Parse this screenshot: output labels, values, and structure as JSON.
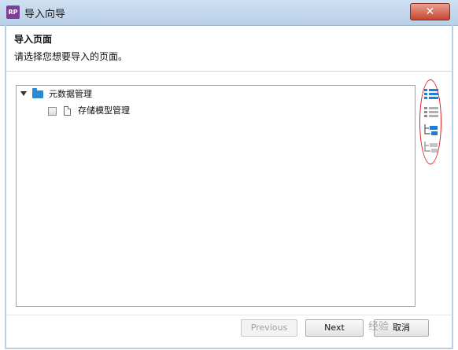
{
  "window": {
    "app_icon_text": "RP",
    "title": "导入向导",
    "close_symbol": "✕"
  },
  "header": {
    "title": "导入页面",
    "description": "请选择您想要导入的页面。"
  },
  "tree": {
    "root": {
      "label": "元数据管理",
      "expanded": true,
      "icon": "folder-icon"
    },
    "children": [
      {
        "label": "存储模型管理",
        "checked": false,
        "icon": "page-icon"
      }
    ]
  },
  "toolbar": {
    "icons": [
      "expand-all-icon",
      "collapse-all-icon",
      "check-all-icon",
      "uncheck-all-icon"
    ]
  },
  "footer": {
    "previous_label": "Previous",
    "next_label": "Next",
    "cancel_label": "取消",
    "watermark_text": "经验"
  },
  "colors": {
    "folder": "#2a8ad3",
    "accent_icon": "#1f7ed0",
    "annotation": "#e02020",
    "close_button": "#c7442f"
  }
}
